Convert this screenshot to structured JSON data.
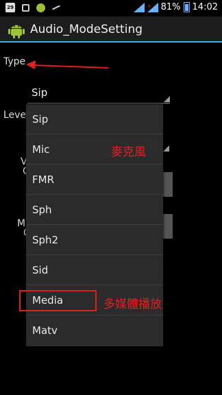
{
  "status_bar": {
    "calendar_day": "29",
    "battery_percent": "81%",
    "time": "14:02"
  },
  "title_bar": {
    "title": "Audio_ModeSetting"
  },
  "type_section": {
    "label": "Type",
    "selected_value": "Sip"
  },
  "level_section": {
    "label": "Level"
  },
  "background_fragments": [
    "V",
    "C",
    "M",
    "C"
  ],
  "dropdown": {
    "options": [
      "Sip",
      "Mic",
      "FMR",
      "Sph",
      "Sph2",
      "Sid",
      "Media",
      "Matv"
    ]
  },
  "annotations": {
    "mic_note": "麥克風",
    "media_note": "多媒體播放",
    "color": "#e02020"
  },
  "colors": {
    "accent": "#33b5e5",
    "annotation": "#e02020"
  }
}
